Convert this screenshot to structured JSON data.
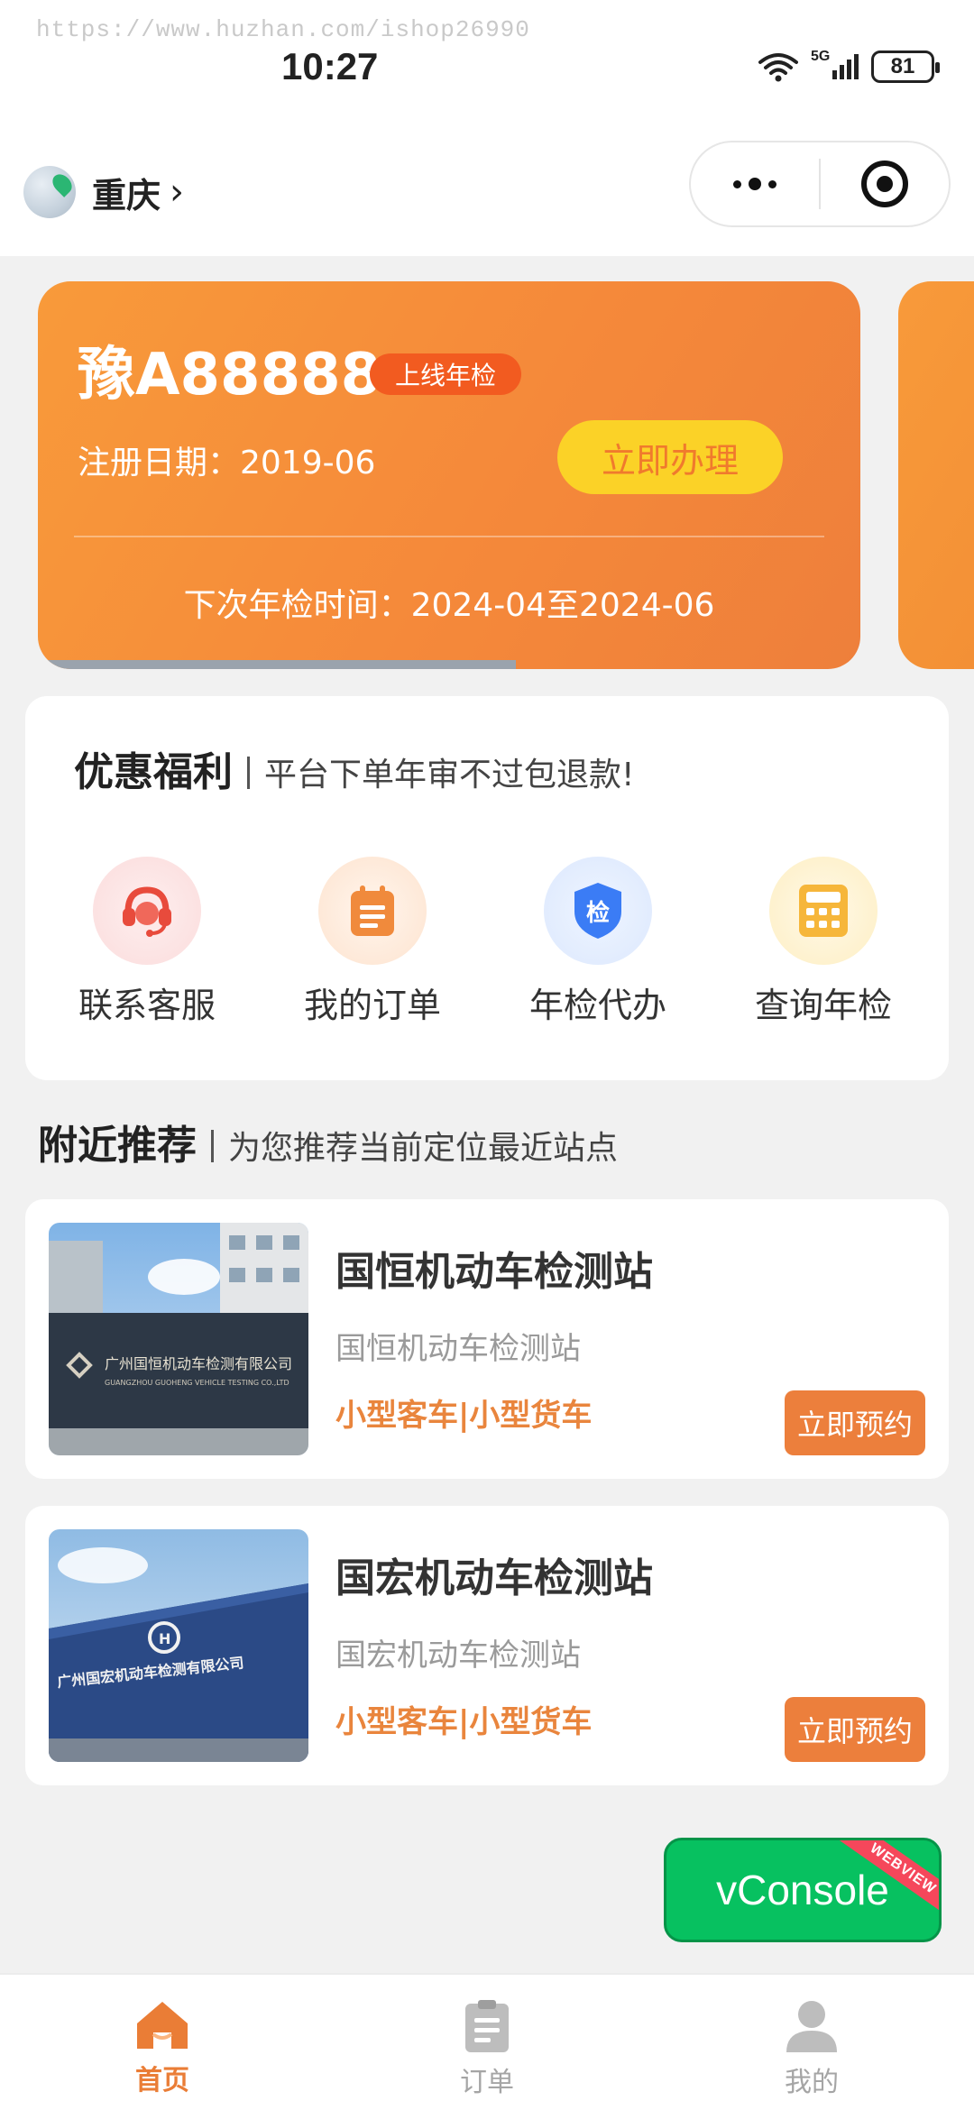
{
  "watermark": "https://www.huzhan.com/ishop26990",
  "status_bar": {
    "time": "10:27",
    "network": "5G",
    "battery": "81"
  },
  "header": {
    "city": "重庆"
  },
  "car_card": {
    "plate": "豫A88888",
    "tag": "上线年检",
    "reg_date": "注册日期：2019-06",
    "action_label": "立即办理",
    "next_check": "下次年检时间：2024-04至2024-06"
  },
  "welfare": {
    "title": "优惠福利",
    "subtitle": "平台下单年审不过包退款!",
    "items": [
      {
        "label": "联系客服",
        "icon": "customer-service-icon"
      },
      {
        "label": "我的订单",
        "icon": "order-icon"
      },
      {
        "label": "年检代办",
        "icon": "inspection-shield-icon",
        "badge": "检"
      },
      {
        "label": "查询年检",
        "icon": "calculator-icon"
      }
    ]
  },
  "nearby": {
    "title": "附近推荐",
    "subtitle": "为您推荐当前定位最近站点",
    "stations": [
      {
        "name": "国恒机动车检测站",
        "sub": "国恒机动车检测站",
        "types": "小型客车|小型货车",
        "action_label": "立即预约",
        "sign_cn": "广州国恒机动车检测有限公司",
        "sign_en": "GUANGZHOU GUOHENG VEHICLE TESTING CO.,LTD"
      },
      {
        "name": "国宏机动车检测站",
        "sub": "国宏机动车检测站",
        "types": "小型客车|小型货车",
        "action_label": "立即预约",
        "sign_cn": "广州国宏机动车检测有限公司"
      }
    ]
  },
  "vconsole": {
    "label": "vConsole",
    "ribbon": "WEBVIEW"
  },
  "tabbar": [
    {
      "label": "首页",
      "icon": "home-icon",
      "active": true
    },
    {
      "label": "订单",
      "icon": "clipboard-icon",
      "active": false
    },
    {
      "label": "我的",
      "icon": "user-icon",
      "active": false
    }
  ],
  "colors": {
    "accent": "#ea7d36",
    "card_orange": "#f5893a",
    "button_yellow": "#fbd227",
    "tag_red_orange": "#f25b20",
    "vconsole_green": "#07c160"
  }
}
